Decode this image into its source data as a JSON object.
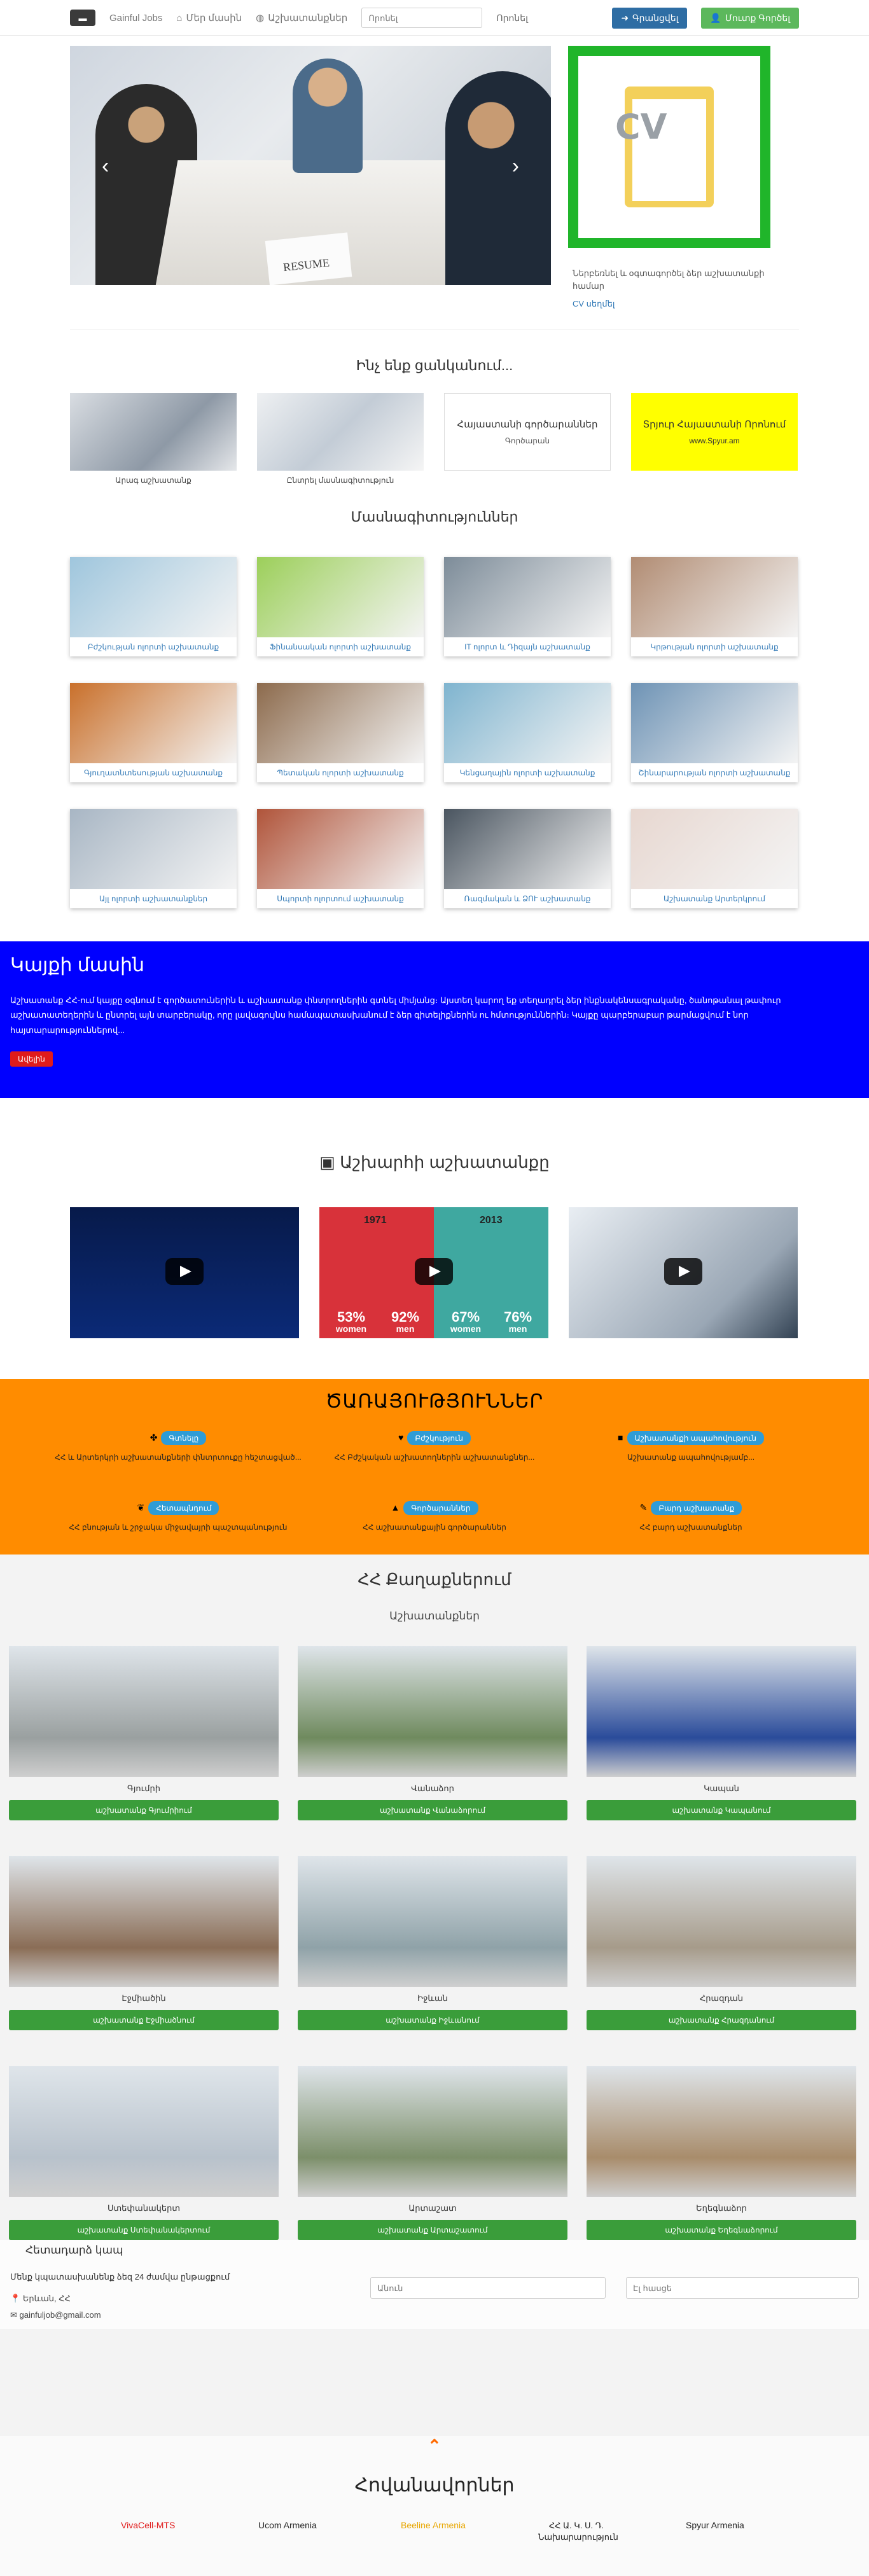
{
  "navbar": {
    "brand": "Gainful Jobs",
    "about": "Մեր մասին",
    "vacancies": "Աշխատանքներ",
    "search_placeholder": "Որոնել",
    "search_button": "Որոնել",
    "login": "Գրանցվել",
    "register": "Մուտք Գործել"
  },
  "hero": {
    "resume_text": "RESUME",
    "cv_label": "CV",
    "cv_desc": "Ներբեռնել և օգտագործել ձեր աշխատանքի համար",
    "cv_link": "CV սեղմել"
  },
  "looking": {
    "title": "Ինչ ենք ցանկանում...",
    "cards": [
      {
        "caption": "Արագ աշխատանք"
      },
      {
        "caption": "Ընտրել մասնագիտություն"
      },
      {
        "big": "Հայաստանի գործարաններ",
        "small": "Գործարան"
      },
      {
        "big": "Տրյուր Հայաստանի Որոնում",
        "small": "www.Spyur.am"
      }
    ]
  },
  "specialties": {
    "title": "Մասնագիտություններ",
    "items": [
      {
        "label": "Բժշկության ոլորտի աշխատանք",
        "color": "#9fc6dd"
      },
      {
        "label": "Ֆինանսական ոլորտի աշխատանք",
        "color": "#9ccf5a"
      },
      {
        "label": "IT ոլորտ և Դիզայն աշխատանք",
        "color": "#7d8c99"
      },
      {
        "label": "Կրթության ոլորտի աշխատանք",
        "color": "#b18c73"
      },
      {
        "label": "Գյուղատնտեսության աշխատանք",
        "color": "#c9702b"
      },
      {
        "label": "Պետական ոլորտի աշխատանք",
        "color": "#8c6a4c"
      },
      {
        "label": "Կենցաղային ոլորտի աշխատանք",
        "color": "#7fb4cf"
      },
      {
        "label": "Շինարարության ոլորտի աշխատանք",
        "color": "#6e93b5"
      },
      {
        "label": "Այլ ոլորտի աշխատանքներ",
        "color": "#a8b6c4"
      },
      {
        "label": "Սպորտի ոլորտում աշխատանք",
        "color": "#b0543a"
      },
      {
        "label": "Ռազմական և ՁՈՒ աշխատանք",
        "color": "#4a5560"
      },
      {
        "label": "Աշխատանք Արտերկրում",
        "color": "#e7d7d0"
      }
    ]
  },
  "about": {
    "title": "Կայքի մասին",
    "text": "Աշխատանք ՀՀ-ում կայքը օգնում է գործատուներին և աշխատանք փնտրողներին գտնել միմյանց։ Այստեղ կարող եք տեղադրել ձեր ինքնակենսագրականը, ծանոթանալ թափուր աշխատատեղերին և ընտրել այն տարբերակը, որը լավագույնս համապատասխանում է ձեր գիտելիքներին ու հմտություններին։ Կայքը պարբերաբար թարմացվում է նոր հայտարարություններով...",
    "more": "Ավելին"
  },
  "videos": {
    "title": "Աշխարհի աշխատանքը",
    "v2": {
      "year1": "1971",
      "year2": "2013",
      "s1": "53%",
      "s2": "92%",
      "s3": "67%",
      "s4": "76%",
      "women": "women",
      "men": "men"
    }
  },
  "services": {
    "title": "ԾԱՌԱՅՈՒԹՅՈՒՆՆԵՐ",
    "items": [
      {
        "tag": "Գտնելը",
        "desc": "ՀՀ և Արտերկրի աշխատանքների փնտրտուքը հեշտացված..."
      },
      {
        "tag": "Բժշկություն",
        "desc": "ՀՀ Բժշկական աշխատողներին աշխատանքներ..."
      },
      {
        "tag": "Աշխատանքի ապահովություն",
        "desc": "Աշխատանք ապահովությամբ..."
      },
      {
        "tag": "Հետապնդում",
        "desc": "ՀՀ բնության և շրջակա միջավայրի պաշտպանություն"
      },
      {
        "tag": "Գործարաններ",
        "desc": "ՀՀ աշխատանքային գործարաններ"
      },
      {
        "tag": "Բարդ աշխատանք",
        "desc": "ՀՀ բարդ աշխատանքներ"
      }
    ]
  },
  "cities": {
    "title": "ՀՀ Քաղաքներում",
    "subtitle": "Աշխատանքներ",
    "items": [
      {
        "name": "Գյումրի",
        "button": "աշխատանք Գյումրիում",
        "color": "#9aa0a0"
      },
      {
        "name": "Վանաձոր",
        "button": "աշխատանք Վանաձորում",
        "color": "#6f8a5e"
      },
      {
        "name": "Կապան",
        "button": "աշխատանք Կապանում",
        "color": "#2a4b9a"
      },
      {
        "name": "Էջմիածին",
        "button": "աշխատանք Էջմիածնում",
        "color": "#8a6d56"
      },
      {
        "name": "Իջևան",
        "button": "աշխատանք Իջևանում",
        "color": "#8fa2a8"
      },
      {
        "name": "Հրազդան",
        "button": "աշխատանք Հրազդանում",
        "color": "#a69b8a"
      },
      {
        "name": "Ստեփանակերտ",
        "button": "աշխատանք Ստեփանակերտում",
        "color": "#b8c2cc"
      },
      {
        "name": "Արտաշատ",
        "button": "աշխատանք Արտաշատում",
        "color": "#7c8f6a"
      },
      {
        "name": "Եղեգնաձոր",
        "button": "աշխատանք Եղեգնաձորում",
        "color": "#a88c6b"
      }
    ]
  },
  "contact": {
    "title": "Հետադարձ կապ",
    "availability": "Մենք կպատասխանենք ձեզ 24 ժամվա ընթացքում",
    "location": "Երևան, ՀՀ",
    "email": "gainfuljob@gmail.com",
    "name_placeholder": "Անուն",
    "email_placeholder": "Էլ հասցե"
  },
  "partners": {
    "title": "Հովանավորներ",
    "items": [
      "VivaCell-MTS",
      "Ucom Armenia",
      "Beeline Armenia",
      "ՀՀ Ա. Կ. Ս. Դ. Նախարարություն",
      "Spyur Armenia"
    ]
  }
}
